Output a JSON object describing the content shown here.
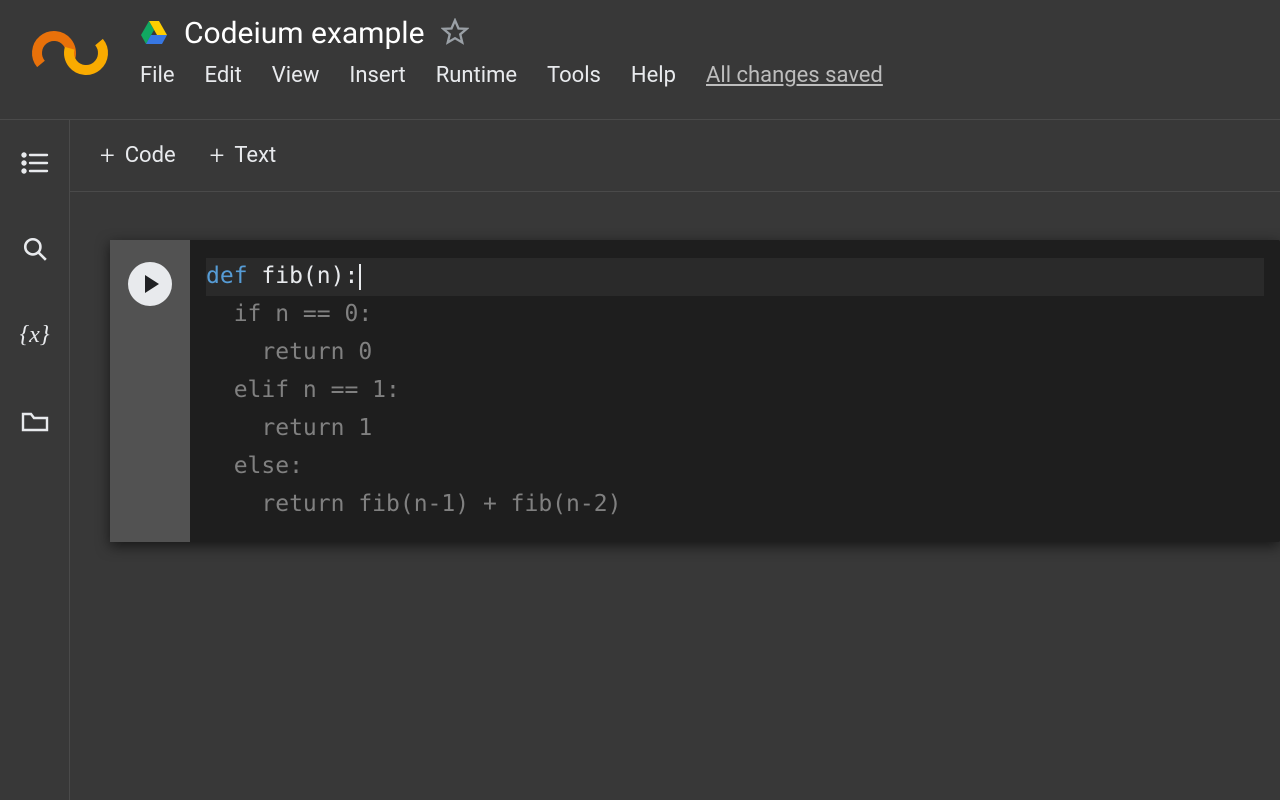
{
  "header": {
    "title": "Codeium example",
    "menu": [
      "File",
      "Edit",
      "View",
      "Insert",
      "Runtime",
      "Tools",
      "Help"
    ],
    "save_status": "All changes saved"
  },
  "toolbar": {
    "code_btn": "Code",
    "text_btn": "Text"
  },
  "sidebar": {
    "icons": [
      "toc-icon",
      "search-icon",
      "variables-icon",
      "files-icon"
    ]
  },
  "cell": {
    "typed_line_kw": "def",
    "typed_line_rest": " fib(n):",
    "ghost_lines": [
      "  if n == 0:",
      "    return 0",
      "  elif n == 1:",
      "    return 1",
      "  else:",
      "    return fib(n-1) + fib(n-2)"
    ]
  }
}
